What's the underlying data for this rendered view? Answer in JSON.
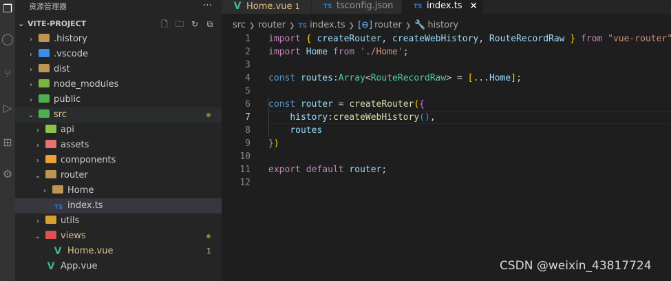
{
  "activity_bar": [
    "files-icon",
    "search-icon",
    "source-control-icon",
    "run-debug-icon",
    "extensions-icon",
    "remote-icon"
  ],
  "sidebar": {
    "title": "资源管理器",
    "more": "···",
    "project": "VITE-PROJECT",
    "actions": [
      "new-file-icon",
      "new-folder-icon",
      "refresh-icon",
      "collapse-icon"
    ],
    "tree": [
      {
        "label": ".history",
        "depth": 1,
        "type": "folder",
        "chevron": "›"
      },
      {
        "label": ".vscode",
        "depth": 1,
        "type": "folder-vscode",
        "chevron": "›"
      },
      {
        "label": "dist",
        "depth": 1,
        "type": "folder-dist",
        "chevron": "›"
      },
      {
        "label": "node_modules",
        "depth": 1,
        "type": "folder-node",
        "chevron": "›"
      },
      {
        "label": "public",
        "depth": 1,
        "type": "folder-public",
        "chevron": "›"
      },
      {
        "label": "src",
        "depth": 1,
        "type": "folder-src",
        "chevron": "⌄",
        "modified": true
      },
      {
        "label": "api",
        "depth": 2,
        "type": "folder-api",
        "chevron": "›"
      },
      {
        "label": "assets",
        "depth": 2,
        "type": "folder-assets",
        "chevron": "›"
      },
      {
        "label": "components",
        "depth": 2,
        "type": "folder-components",
        "chevron": "›"
      },
      {
        "label": "router",
        "depth": 2,
        "type": "folder",
        "chevron": "⌄"
      },
      {
        "label": "Home",
        "depth": 3,
        "type": "folder",
        "chevron": "›"
      },
      {
        "label": "index.ts",
        "depth": 3,
        "type": "ts",
        "chevron": ""
      },
      {
        "label": "utils",
        "depth": 2,
        "type": "folder-utils",
        "chevron": "›"
      },
      {
        "label": "views",
        "depth": 2,
        "type": "folder-views",
        "chevron": "⌄",
        "modified": true
      },
      {
        "label": "Home.vue",
        "depth": 3,
        "type": "vue",
        "chevron": "",
        "modified_count": "1"
      },
      {
        "label": "App.vue",
        "depth": 2,
        "type": "vue",
        "chevron": ""
      }
    ]
  },
  "tabs": [
    {
      "label": "Home.vue",
      "badge": "1",
      "icon": "vue-icon",
      "icon_text": "V"
    },
    {
      "label": "tsconfig.json",
      "badge": "",
      "icon": "ts-icon",
      "icon_text": "TS"
    },
    {
      "label": "index.ts",
      "badge": "",
      "icon": "ts-icon",
      "icon_text": "TS",
      "close": "✕"
    }
  ],
  "breadcrumbs": {
    "src": "src",
    "router": "router",
    "ts_badge": "TS",
    "file": "index.ts",
    "sym1_icon": "[⊖]",
    "sym1": "router",
    "sym2_icon": "🔧",
    "sym2": "history"
  },
  "line_numbers": [
    "1",
    "2",
    "3",
    "4",
    "5",
    "6",
    "7",
    "8",
    "9",
    "10",
    "11",
    "12"
  ],
  "current_line": "7",
  "code": [
    {
      "parts": [
        [
          "ctl",
          "import "
        ],
        [
          "br",
          "{ "
        ],
        [
          "var",
          "createRouter"
        ],
        [
          "",
          ", "
        ],
        [
          "var",
          "createWebHistory"
        ],
        [
          "",
          ", "
        ],
        [
          "var",
          "RouteRecordRaw"
        ],
        [
          "br",
          " }"
        ],
        [
          "ctl",
          " from "
        ],
        [
          "str",
          "\"vue-router\""
        ],
        [
          "",
          ";"
        ]
      ]
    },
    {
      "parts": [
        [
          "ctl",
          "import "
        ],
        [
          "var",
          "Home"
        ],
        [
          "ctl",
          " from "
        ],
        [
          "str",
          "'./Home'"
        ],
        [
          "",
          ";"
        ]
      ]
    },
    {
      "parts": []
    },
    {
      "parts": [
        [
          "kw",
          "const "
        ],
        [
          "var",
          "routes"
        ],
        [
          "",
          ":"
        ],
        [
          "ty",
          "Array"
        ],
        [
          "",
          "<"
        ],
        [
          "ty",
          "RouteRecordRaw"
        ],
        [
          "",
          "> = "
        ],
        [
          "br",
          "["
        ],
        [
          "",
          "..."
        ],
        [
          "var",
          "Home"
        ],
        [
          "br",
          "]"
        ],
        [
          "",
          ";"
        ]
      ]
    },
    {
      "parts": []
    },
    {
      "parts": [
        [
          "kw",
          "const "
        ],
        [
          "var",
          "router"
        ],
        [
          "",
          " = "
        ],
        [
          "fn",
          "createRouter"
        ],
        [
          "br",
          "("
        ],
        [
          "br2",
          "{"
        ]
      ]
    },
    {
      "parts": [
        [
          "",
          "    "
        ],
        [
          "var",
          "history"
        ],
        [
          "",
          ":"
        ],
        [
          "fn",
          "createWebHistory"
        ],
        [
          "br3",
          "()"
        ],
        [
          "",
          ","
        ]
      ]
    },
    {
      "parts": [
        [
          "",
          "    "
        ],
        [
          "var",
          "routes"
        ]
      ]
    },
    {
      "parts": [
        [
          "br2",
          "}"
        ],
        [
          "br",
          ")"
        ]
      ]
    },
    {
      "parts": []
    },
    {
      "parts": [
        [
          "ctl",
          "export "
        ],
        [
          "ctl",
          "default "
        ],
        [
          "var",
          "router"
        ],
        [
          "",
          ";"
        ]
      ]
    },
    {
      "parts": []
    }
  ],
  "watermark": "CSDN @weixin_43817724",
  "colors": {
    "editor_bg": "#1e1e1e",
    "sidebar_bg": "#252526",
    "activity_bg": "#333333",
    "modified": "#e2c08d",
    "ts_blue": "#3178c6",
    "vue_green": "#41b883"
  }
}
